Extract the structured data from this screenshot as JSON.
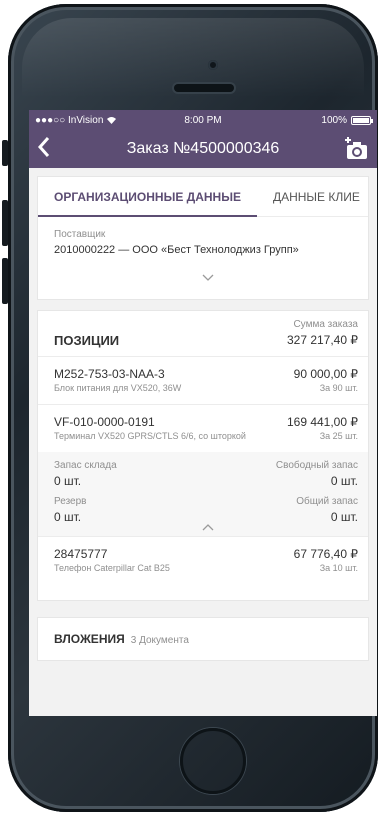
{
  "status_bar": {
    "carrier": "●●●○○ InVision",
    "time": "8:00 PM",
    "battery": "100%"
  },
  "nav": {
    "back_label": "<",
    "title": "Заказ №4500000346"
  },
  "tabs": [
    {
      "label": "ОРГАНИЗАЦИОННЫЕ ДАННЫЕ",
      "active": true
    },
    {
      "label": "ДАННЫЕ КЛИЕ",
      "active": false
    }
  ],
  "org": {
    "supplier_label": "Поставщик",
    "supplier_value": "2010000222 — ООО «Бест Технолоджиз Групп»"
  },
  "positions": {
    "heading": "ПОЗИЦИИ",
    "total_label": "Сумма заказа",
    "total_value": "327 217,40 ₽",
    "items": [
      {
        "code": "M252-753-03-NAA-3",
        "desc": "Блок питания для VX520, 36W",
        "price": "90 000,00 ₽",
        "qty": "За 90 шт."
      },
      {
        "code": "VF-010-0000-0191",
        "desc": "Терминал VX520 GPRS/CTLS 6/6, со шторкой",
        "price": "169 441,00 ₽",
        "qty": "За 25 шт."
      }
    ],
    "stock": {
      "warehouse_label": "Запас склада",
      "warehouse_value": "0 шт.",
      "free_label": "Свободный запас",
      "free_value": "0 шт.",
      "reserve_label": "Резерв",
      "reserve_value": "0 шт.",
      "total_label": "Общий запас",
      "total_value": "0 шт."
    },
    "item3": {
      "code": "28475777",
      "desc": "Телефон Caterpillar Cat B25",
      "price": "67 776,40 ₽",
      "qty": "За 10 шт."
    }
  },
  "attachments": {
    "heading": "ВЛОЖЕНИЯ",
    "count": "3 Документа"
  }
}
